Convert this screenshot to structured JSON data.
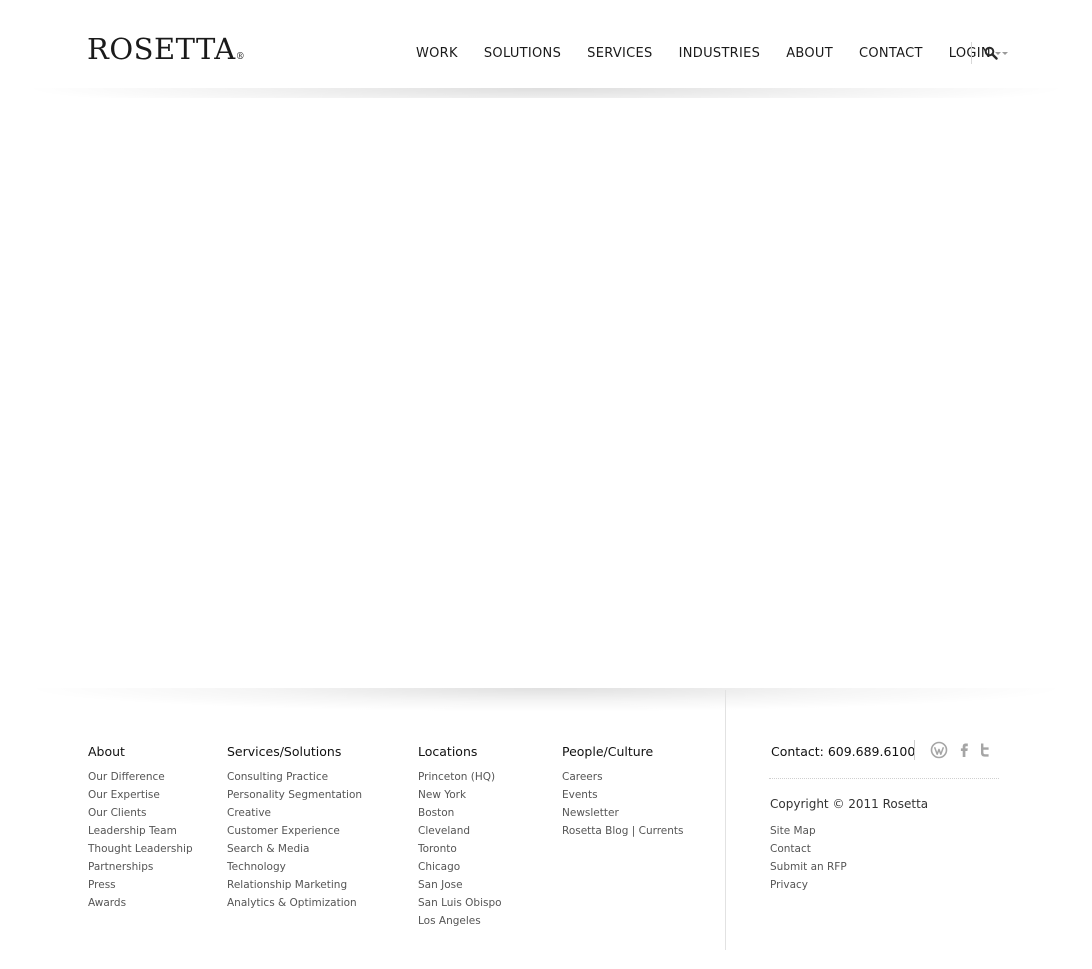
{
  "header": {
    "logo": "ROSETTA",
    "logo_mark": "®",
    "nav": [
      "WORK",
      "SOLUTIONS",
      "SERVICES",
      "INDUSTRIES",
      "ABOUT",
      "CONTACT"
    ],
    "login_label": "LOGIN",
    "search_icon": "search-icon"
  },
  "footer": {
    "columns": [
      {
        "title": "About",
        "items": [
          "Our Difference",
          "Our Expertise",
          "Our Clients",
          "Leadership Team",
          "Thought Leadership",
          "Partnerships",
          "Press",
          "Awards"
        ]
      },
      {
        "title": "Services/Solutions",
        "items": [
          "Consulting Practice",
          "Personality Segmentation",
          "Creative",
          "Customer Experience",
          "Search & Media",
          "Technology",
          "Relationship Marketing",
          "Analytics & Optimization"
        ]
      },
      {
        "title": "Locations",
        "items": [
          "Princeton (HQ)",
          "New York",
          "Boston",
          "Cleveland",
          "Toronto",
          "Chicago",
          "San Jose",
          "San Luis Obispo",
          "Los Angeles"
        ]
      },
      {
        "title": "People/Culture",
        "items": [
          "Careers",
          "Events",
          "Newsletter",
          "Rosetta Blog | Currents"
        ]
      }
    ],
    "contact": "Contact: 609.689.6100",
    "social_icons": [
      "wordpress-icon",
      "facebook-icon",
      "twitter-icon"
    ],
    "copyright": "Copyright © 2011 Rosetta",
    "legal_links": [
      "Site Map",
      "Contact",
      "Submit an RFP",
      "Privacy"
    ]
  },
  "colors": {
    "text": "#1a1a1a",
    "link": "#555555",
    "icon": "#9a9a9a",
    "divider": "#e2e2e2"
  }
}
